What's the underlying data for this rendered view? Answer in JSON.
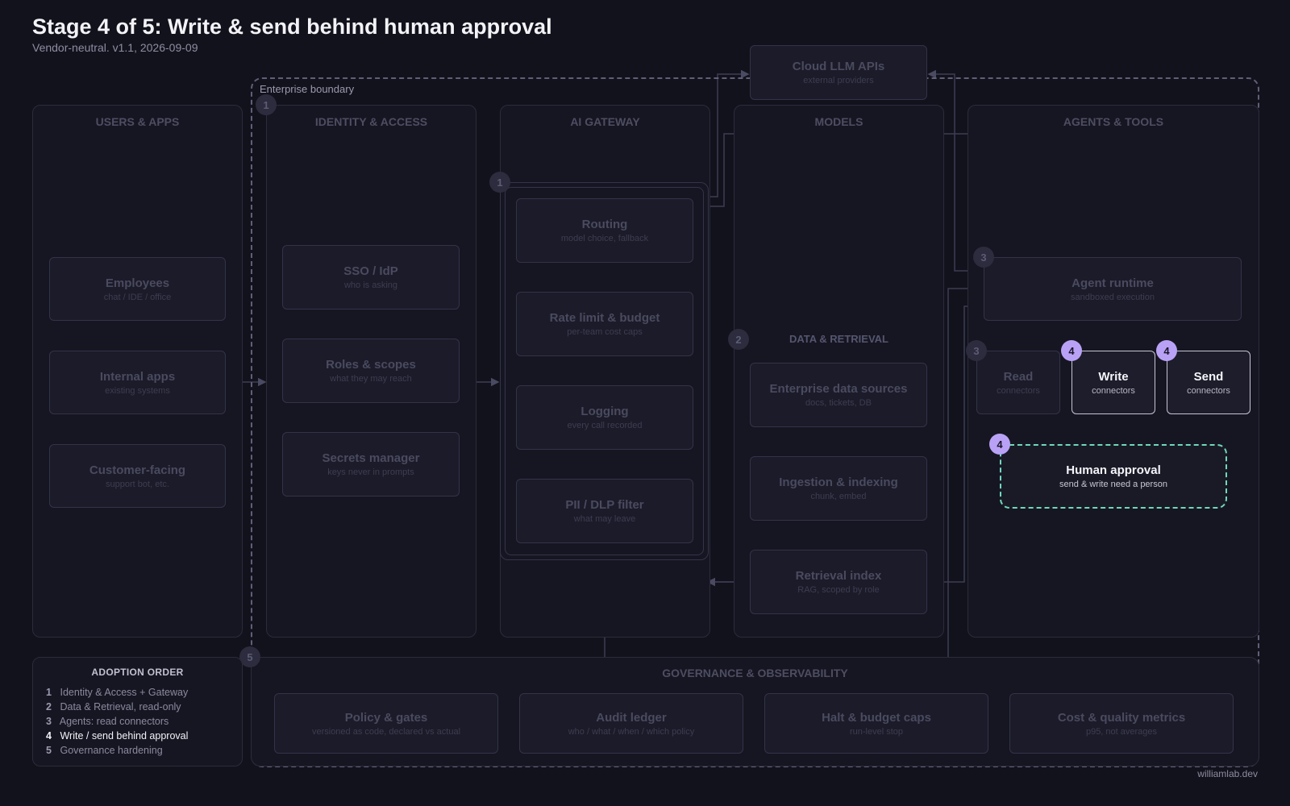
{
  "header": {
    "title": "Stage 4 of 5: Write & send behind human approval",
    "subtitle": "Vendor-neutral. v1.1, 2026-09-09"
  },
  "boundary_label": "Enterprise boundary",
  "cloud": {
    "title": "Cloud LLM APIs",
    "subtitle": "external providers"
  },
  "columns": {
    "users": {
      "title": "USERS & APPS",
      "boxes": [
        {
          "title": "Employees",
          "subtitle": "chat / IDE / office"
        },
        {
          "title": "Internal apps",
          "subtitle": "existing systems"
        },
        {
          "title": "Customer-facing",
          "subtitle": "support bot, etc."
        }
      ]
    },
    "identity": {
      "title": "IDENTITY & ACCESS",
      "badge": "1",
      "boxes": [
        {
          "title": "SSO / IdP",
          "subtitle": "who is asking"
        },
        {
          "title": "Roles & scopes",
          "subtitle": "what they may reach"
        },
        {
          "title": "Secrets manager",
          "subtitle": "keys never in prompts"
        }
      ]
    },
    "gateway": {
      "title": "AI GATEWAY",
      "badge": "1",
      "boxes": [
        {
          "title": "Routing",
          "subtitle": "model choice, fallback"
        },
        {
          "title": "Rate limit & budget",
          "subtitle": "per-team cost caps"
        },
        {
          "title": "Logging",
          "subtitle": "every call recorded"
        },
        {
          "title": "PII / DLP filter",
          "subtitle": "what may leave"
        }
      ]
    },
    "models": {
      "title": "MODELS",
      "data_title": "DATA & RETRIEVAL",
      "badge": "2",
      "boxes": [
        {
          "title": "Enterprise data sources",
          "subtitle": "docs, tickets, DB"
        },
        {
          "title": "Ingestion & indexing",
          "subtitle": "chunk, embed"
        },
        {
          "title": "Retrieval index",
          "subtitle": "RAG, scoped by role"
        }
      ]
    },
    "agents": {
      "title": "AGENTS & TOOLS",
      "runtime": {
        "title": "Agent runtime",
        "subtitle": "sandboxed execution",
        "badge": "3"
      },
      "read": {
        "title": "Read",
        "subtitle": "connectors",
        "badge": "3"
      },
      "write": {
        "title": "Write",
        "subtitle": "connectors",
        "badge": "4"
      },
      "send": {
        "title": "Send",
        "subtitle": "connectors",
        "badge": "4"
      },
      "approval": {
        "title": "Human approval",
        "subtitle": "send & write need a person",
        "badge": "4"
      }
    }
  },
  "governance": {
    "title": "GOVERNANCE & OBSERVABILITY",
    "badge": "5",
    "boxes": [
      {
        "title": "Policy & gates",
        "subtitle": "versioned as code, declared vs actual"
      },
      {
        "title": "Audit ledger",
        "subtitle": "who / what / when / which policy"
      },
      {
        "title": "Halt & budget caps",
        "subtitle": "run-level stop"
      },
      {
        "title": "Cost & quality metrics",
        "subtitle": "p95, not averages"
      }
    ]
  },
  "legend": {
    "title": "ADOPTION ORDER",
    "items": [
      {
        "num": "1",
        "label": "Identity & Access + Gateway"
      },
      {
        "num": "2",
        "label": "Data & Retrieval, read-only"
      },
      {
        "num": "3",
        "label": "Agents: read connectors"
      },
      {
        "num": "4",
        "label": "Write / send behind approval"
      },
      {
        "num": "5",
        "label": "Governance hardening"
      }
    ]
  },
  "footer": "williamlab.dev",
  "colors": {
    "background": "#12121c",
    "active_badge": "#b9a2f5",
    "approval_border": "#6fd9b8"
  }
}
